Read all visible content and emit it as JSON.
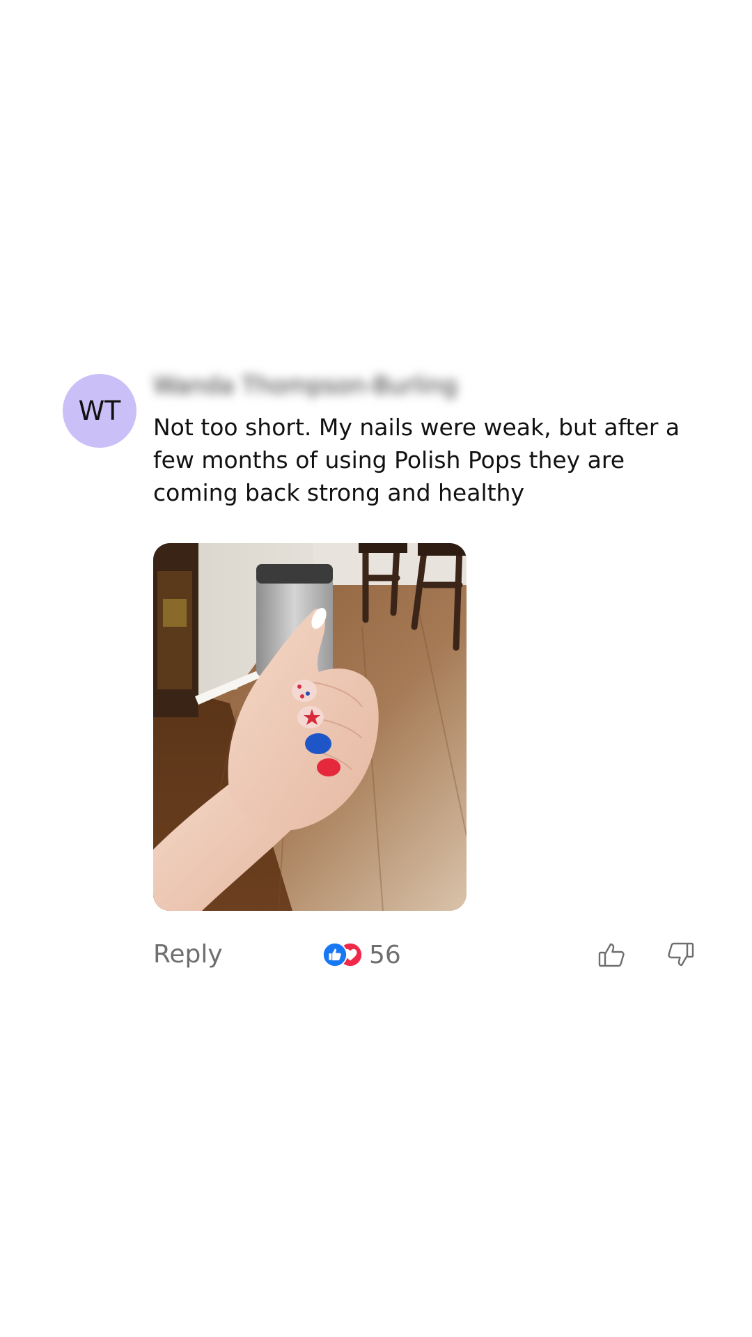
{
  "comment": {
    "avatar_initials": "WT",
    "avatar_color": "#cbbff8",
    "author_name": "Wanda Thompson-Burling",
    "text": "Not too short. My nails were weak, but after a few months of using Polish Pops they are coming back strong and healthy",
    "photo_alt": "hand-with-painted-nails-photo"
  },
  "actions": {
    "reply_label": "Reply",
    "reaction_count": "56",
    "reaction_icons": [
      "like-reaction-icon",
      "love-reaction-icon"
    ],
    "like_color": "#1877f2",
    "love_color": "#f02849",
    "vote_icons": [
      "thumbs-up-icon",
      "thumbs-down-icon"
    ]
  }
}
